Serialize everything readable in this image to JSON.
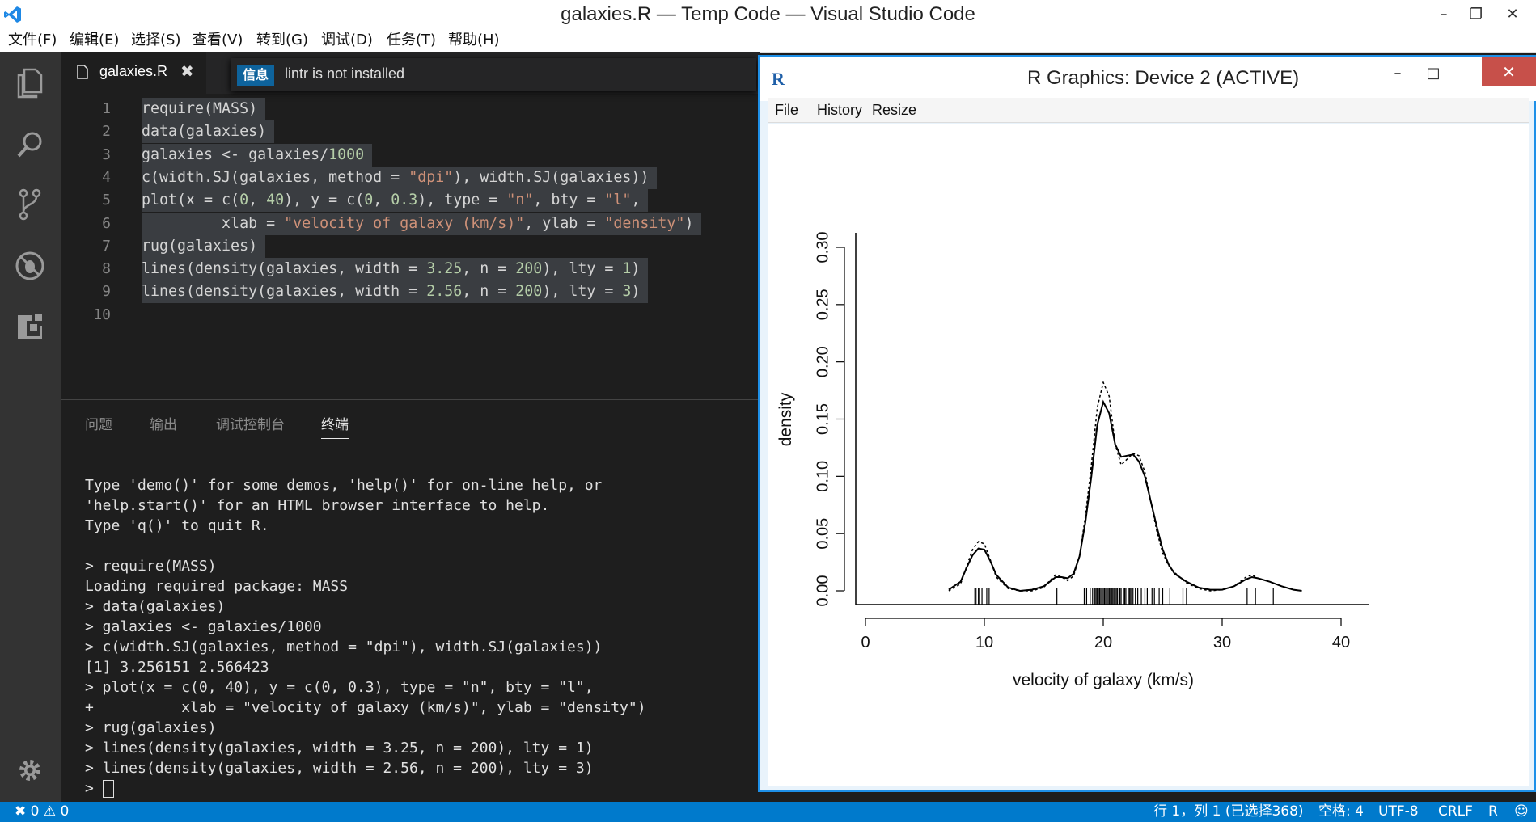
{
  "window": {
    "title": "galaxies.R — Temp Code — Visual Studio Code"
  },
  "menubar": {
    "items": [
      "文件(F)",
      "编辑(E)",
      "选择(S)",
      "查看(V)",
      "转到(G)",
      "调试(D)",
      "任务(T)",
      "帮助(H)"
    ]
  },
  "activitybar": {
    "icons": [
      "files-icon",
      "search-icon",
      "source-control-icon",
      "debug-icon",
      "extensions-icon",
      "gear-icon"
    ]
  },
  "editor": {
    "tab_label": "galaxies.R",
    "notification": {
      "badge": "信息",
      "message": "lintr is not installed"
    },
    "lines": [
      {
        "no": "1",
        "text": "require(MASS)"
      },
      {
        "no": "2",
        "text": "data(galaxies)"
      },
      {
        "no": "3",
        "text": "galaxies <- galaxies/1000"
      },
      {
        "no": "4",
        "text": "c(width.SJ(galaxies, method = \"dpi\"), width.SJ(galaxies))"
      },
      {
        "no": "5",
        "text": "plot(x = c(0, 40), y = c(0, 0.3), type = \"n\", bty = \"l\","
      },
      {
        "no": "6",
        "text": "         xlab = \"velocity of galaxy (km/s)\", ylab = \"density\")"
      },
      {
        "no": "7",
        "text": "rug(galaxies)"
      },
      {
        "no": "8",
        "text": "lines(density(galaxies, width = 3.25, n = 200), lty = 1)"
      },
      {
        "no": "9",
        "text": "lines(density(galaxies, width = 2.56, n = 200), lty = 3)"
      },
      {
        "no": "10",
        "text": ""
      }
    ]
  },
  "panel": {
    "tabs": [
      {
        "label": "问题",
        "active": false
      },
      {
        "label": "输出",
        "active": false
      },
      {
        "label": "调试控制台",
        "active": false
      },
      {
        "label": "终端",
        "active": true
      }
    ],
    "terminal_lines": [
      "Type 'demo()' for some demos, 'help()' for on-line help, or",
      "'help.start()' for an HTML browser interface to help.",
      "Type 'q()' to quit R.",
      "",
      "> require(MASS)",
      "Loading required package: MASS",
      "> data(galaxies)",
      "> galaxies <- galaxies/1000",
      "> c(width.SJ(galaxies, method = \"dpi\"), width.SJ(galaxies))",
      "[1] 3.256151 2.566423",
      "> plot(x = c(0, 40), y = c(0, 0.3), type = \"n\", bty = \"l\",",
      "+          xlab = \"velocity of galaxy (km/s)\", ylab = \"density\")",
      "> rug(galaxies)",
      "> lines(density(galaxies, width = 3.25, n = 200), lty = 1)",
      "> lines(density(galaxies, width = 2.56, n = 200), lty = 3)"
    ],
    "prompt": ">"
  },
  "rgraphics": {
    "logo": "R",
    "title": "R Graphics: Device 2 (ACTIVE)",
    "menu": [
      "File",
      "History",
      "Resize"
    ]
  },
  "chart_data": {
    "type": "line",
    "xlabel": "velocity of galaxy (km/s)",
    "ylabel": "density",
    "xlim": [
      0,
      40
    ],
    "ylim": [
      0,
      0.3
    ],
    "xticks": [
      "0",
      "10",
      "20",
      "30",
      "40"
    ],
    "yticks": [
      "0.00",
      "0.05",
      "0.10",
      "0.15",
      "0.20",
      "0.25",
      "0.30"
    ],
    "series": [
      {
        "line_style": "solid",
        "x": [
          7,
          8,
          8.5,
          9,
          9.5,
          10,
          10.5,
          11,
          12,
          13,
          14,
          15,
          15.5,
          16,
          16.5,
          17,
          17.5,
          18,
          18.5,
          19,
          19.5,
          20,
          20.5,
          21,
          21.5,
          22,
          22.5,
          23,
          23.5,
          24,
          24.5,
          25,
          25.5,
          26,
          27,
          28,
          29,
          30,
          31,
          32,
          32.5,
          33,
          34,
          35,
          36,
          36.7
        ],
        "y": [
          0.001,
          0.008,
          0.02,
          0.031,
          0.037,
          0.036,
          0.026,
          0.014,
          0.003,
          0.0,
          0.001,
          0.004,
          0.008,
          0.012,
          0.012,
          0.011,
          0.015,
          0.03,
          0.06,
          0.1,
          0.145,
          0.165,
          0.155,
          0.128,
          0.117,
          0.118,
          0.119,
          0.113,
          0.1,
          0.078,
          0.056,
          0.036,
          0.023,
          0.015,
          0.008,
          0.003,
          0.001,
          0.001,
          0.004,
          0.01,
          0.012,
          0.011,
          0.008,
          0.004,
          0.001,
          0.0
        ]
      },
      {
        "line_style": "dotted",
        "x": [
          7,
          8,
          8.5,
          9,
          9.5,
          10,
          10.5,
          11,
          12,
          13,
          14,
          15,
          15.5,
          16,
          16.5,
          17,
          17.5,
          18,
          18.5,
          19,
          19.5,
          20,
          20.5,
          21,
          21.5,
          22,
          22.5,
          23,
          23.5,
          24,
          24.5,
          25,
          25.5,
          26,
          27,
          28,
          29,
          30,
          31,
          32,
          32.5,
          33,
          34,
          35,
          36,
          36.7
        ],
        "y": [
          0.0,
          0.006,
          0.021,
          0.036,
          0.043,
          0.041,
          0.027,
          0.012,
          0.002,
          0.0,
          0.0,
          0.003,
          0.009,
          0.014,
          0.012,
          0.009,
          0.013,
          0.03,
          0.065,
          0.11,
          0.16,
          0.182,
          0.17,
          0.128,
          0.11,
          0.115,
          0.12,
          0.118,
          0.104,
          0.078,
          0.052,
          0.033,
          0.022,
          0.016,
          0.007,
          0.002,
          0.0,
          0.001,
          0.004,
          0.012,
          0.014,
          0.011,
          0.008,
          0.004,
          0.001,
          0.0
        ]
      }
    ],
    "rug": [
      9.2,
      9.3,
      9.5,
      9.6,
      9.8,
      10.2,
      10.4,
      16.1,
      18.4,
      18.6,
      18.9,
      19.1,
      19.3,
      19.4,
      19.5,
      19.6,
      19.7,
      19.8,
      19.9,
      20.0,
      20.1,
      20.2,
      20.3,
      20.4,
      20.5,
      20.6,
      20.7,
      20.8,
      20.9,
      21.0,
      21.1,
      21.2,
      21.4,
      21.5,
      21.7,
      21.8,
      21.9,
      22.1,
      22.2,
      22.3,
      22.4,
      22.5,
      22.7,
      22.9,
      23.2,
      23.5,
      23.7,
      24.1,
      24.3,
      24.7,
      25.0,
      25.6,
      26.7,
      27.0,
      32.1,
      32.8,
      34.3
    ]
  },
  "statusbar": {
    "errors": "0",
    "warnings": "0",
    "position": "行 1，列 1 (已选择368)",
    "indent": "空格: 4",
    "encoding": "UTF-8",
    "eol": "CRLF",
    "language": "R"
  }
}
